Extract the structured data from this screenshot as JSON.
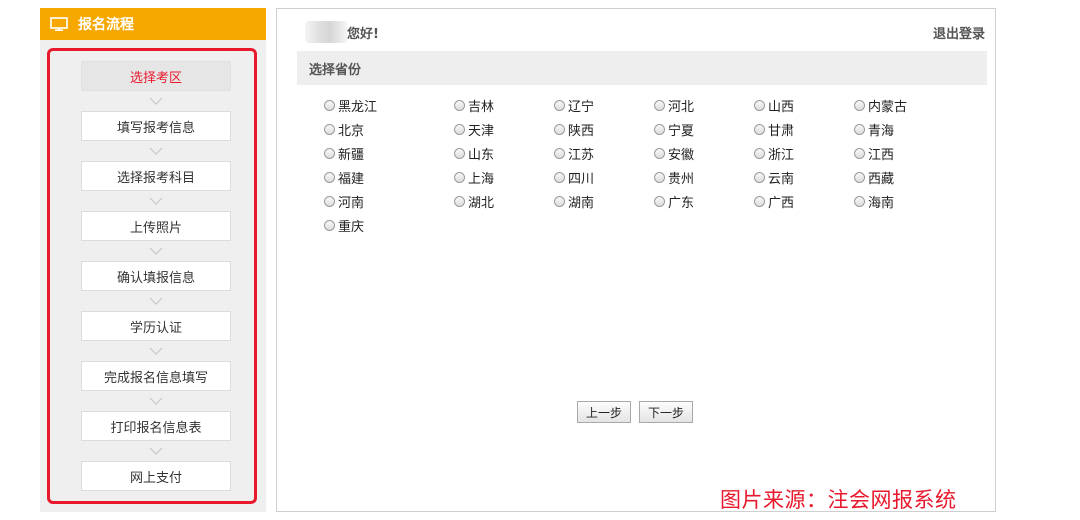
{
  "sidebar": {
    "title": "报名流程",
    "steps": [
      {
        "label": "选择考区",
        "active": true
      },
      {
        "label": "填写报考信息"
      },
      {
        "label": "选择报考科目"
      },
      {
        "label": "上传照片"
      },
      {
        "label": "确认填报信息"
      },
      {
        "label": "学历认证"
      },
      {
        "label": "完成报名信息填写"
      },
      {
        "label": "打印报名信息表"
      },
      {
        "label": "网上支付"
      }
    ]
  },
  "header": {
    "greeting": "您好!",
    "logout_label": "退出登录"
  },
  "province_section": {
    "title": "选择省份",
    "rows": [
      [
        "黑龙江",
        "吉林",
        "辽宁",
        "河北",
        "山西",
        "内蒙古"
      ],
      [
        "北京",
        "天津",
        "陕西",
        "宁夏",
        "甘肃",
        "青海"
      ],
      [
        "新疆",
        "山东",
        "江苏",
        "安徽",
        "浙江",
        "江西"
      ],
      [
        "福建",
        "上海",
        "四川",
        "贵州",
        "云南",
        "西藏"
      ],
      [
        "河南",
        "湖北",
        "湖南",
        "广东",
        "广西",
        "海南"
      ],
      [
        "重庆"
      ]
    ]
  },
  "buttons": {
    "prev_label": "上一步",
    "next_label": "下一步"
  },
  "watermark": "图片来源：注会网报系统",
  "colors": {
    "header_orange": "#f6a800",
    "highlight_red": "#e8192c"
  }
}
